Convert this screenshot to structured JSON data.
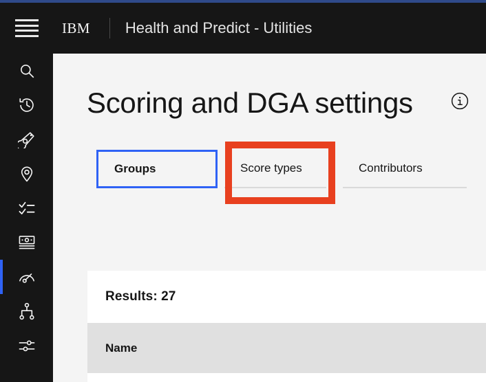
{
  "colors": {
    "accent_top_bar": "#2f4a8a",
    "header_bg": "#161616",
    "rail_active": "#2f62f5",
    "focus_blue": "#2f62f5",
    "annotation_red": "#e8401f",
    "page_bg": "#f4f4f4",
    "table_header_bg": "#e0e0e0",
    "card_bg": "#ffffff"
  },
  "header": {
    "menu_icon": "hamburger-menu-icon",
    "brand": "IBM",
    "app_title": "Health and Predict - Utilities"
  },
  "sidebar": {
    "items": [
      {
        "icon": "search-icon",
        "label": "Search",
        "active": false
      },
      {
        "icon": "history-icon",
        "label": "History",
        "active": false
      },
      {
        "icon": "asset-tag-icon",
        "label": "Assets",
        "active": false
      },
      {
        "icon": "location-pin-icon",
        "label": "Locations",
        "active": false
      },
      {
        "icon": "checklist-icon",
        "label": "Work orders",
        "active": false
      },
      {
        "icon": "currency-bill-icon",
        "label": "Costs",
        "active": false
      },
      {
        "icon": "gauge-meter-icon",
        "label": "Health and scoring",
        "active": true
      },
      {
        "icon": "hierarchy-tree-icon",
        "label": "Hierarchy",
        "active": false
      },
      {
        "icon": "settings-sliders-icon",
        "label": "Settings",
        "active": false
      }
    ]
  },
  "main": {
    "page_title": "Scoring and DGA settings",
    "info_icon": "information-icon",
    "tabs": [
      {
        "label": "Groups",
        "selected": true,
        "focused": true,
        "annotated": false
      },
      {
        "label": "Score types",
        "selected": false,
        "focused": false,
        "annotated": true
      },
      {
        "label": "Contributors",
        "selected": false,
        "focused": false,
        "annotated": false
      }
    ],
    "results": {
      "label": "Results: 27",
      "count": 27
    },
    "table": {
      "columns": [
        "Name"
      ],
      "rows": []
    }
  }
}
